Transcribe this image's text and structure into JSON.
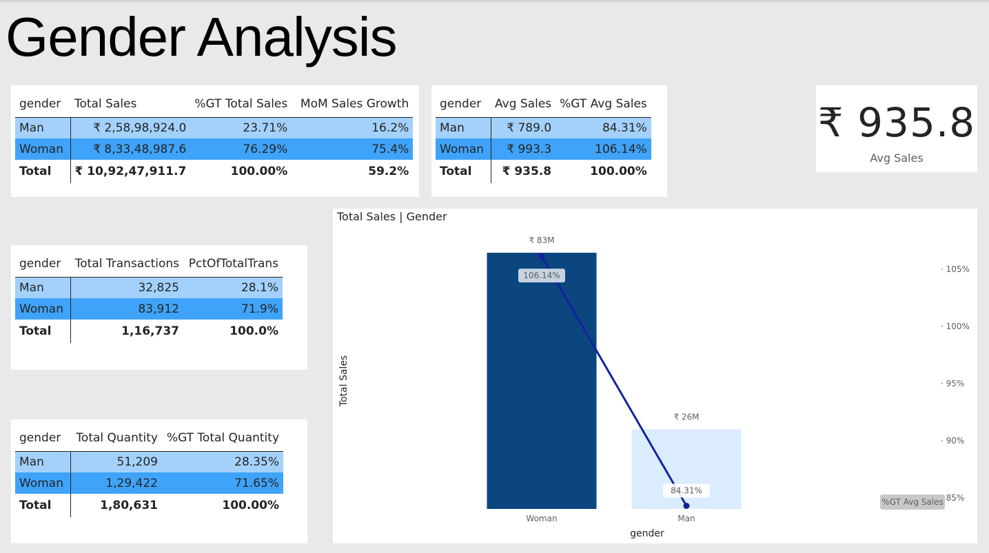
{
  "page": {
    "title": "Gender Analysis"
  },
  "sales_table": {
    "headers": [
      "gender",
      "Total Sales",
      "%GT Total Sales",
      "MoM Sales Growth"
    ],
    "rows": [
      [
        "Man",
        "₹ 2,58,98,924.0",
        "23.71%",
        "16.2%"
      ],
      [
        "Woman",
        "₹ 8,33,48,987.6",
        "76.29%",
        "75.4%"
      ]
    ],
    "total": [
      "Total",
      "₹ 10,92,47,911.7",
      "100.00%",
      "59.2%"
    ]
  },
  "avg_table": {
    "headers": [
      "gender",
      "Avg Sales",
      "%GT Avg Sales"
    ],
    "rows": [
      [
        "Man",
        "₹ 789.0",
        "84.31%"
      ],
      [
        "Woman",
        "₹ 993.3",
        "106.14%"
      ]
    ],
    "total": [
      "Total",
      "₹ 935.8",
      "100.00%"
    ]
  },
  "kpi": {
    "value": "₹ 935.8",
    "label": "Avg Sales"
  },
  "trans_table": {
    "headers": [
      "gender",
      "Total Transactions",
      "PctOfTotalTrans"
    ],
    "rows": [
      [
        "Man",
        "32,825",
        "28.1%"
      ],
      [
        "Woman",
        "83,912",
        "71.9%"
      ]
    ],
    "total": [
      "Total",
      "1,16,737",
      "100.0%"
    ]
  },
  "qty_table": {
    "headers": [
      "gender",
      "Total Quantity",
      "%GT Total Quantity"
    ],
    "rows": [
      [
        "Man",
        "51,209",
        "28.35%"
      ],
      [
        "Woman",
        "1,29,422",
        "71.65%"
      ]
    ],
    "total": [
      "Total",
      "1,80,631",
      "100.00%"
    ]
  },
  "chart_title": "Total Sales | Gender",
  "chart_data": {
    "type": "bar",
    "title": "Total Sales | Gender",
    "xlabel": "gender",
    "ylabel": "Total Sales",
    "categories": [
      "Woman",
      "Man"
    ],
    "series": [
      {
        "name": "Total Sales",
        "values": [
          83348987.6,
          25898924.0
        ],
        "labels": [
          "₹ 83M",
          "₹ 26M"
        ],
        "colors": [
          "#0b467f",
          "#dbecfe"
        ]
      },
      {
        "name": "%GT Avg Sales",
        "values": [
          106.14,
          84.31
        ],
        "labels": [
          "106.14%",
          "84.31%"
        ],
        "color": "#12239e"
      }
    ],
    "y2_ticks": [
      "105%",
      "100%",
      "95%",
      "90%",
      "85%"
    ],
    "y2_tick_values": [
      105,
      100,
      95,
      90,
      85
    ],
    "y2_lim": [
      85,
      107
    ],
    "ylim": [
      0,
      83348987.6
    ],
    "legend_label": "%GT Avg Sales"
  }
}
